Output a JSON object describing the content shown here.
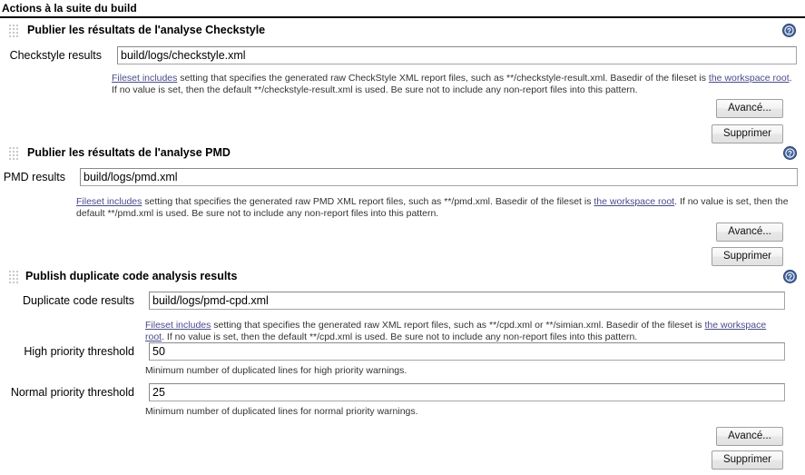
{
  "page": {
    "header_title": "Actions à la suite du build"
  },
  "icons": {
    "help": "help-icon",
    "drag": "drag-handle-icon"
  },
  "common": {
    "advanced_label": "Avancé...",
    "delete_label": "Supprimer",
    "fileset_includes_link": "Fileset includes",
    "workspace_root_link": "the workspace root"
  },
  "sections": [
    {
      "title": "Publier les résultats de l'analyse Checkstyle",
      "fields": [
        {
          "label": "Checkstyle results",
          "value": "build/logs/checkstyle.xml",
          "placeholder": ""
        }
      ],
      "description": {
        "link1": "Fileset includes",
        "text1": " setting that specifies the generated raw CheckStyle XML report files, such as **/checkstyle-result.xml. Basedir of the fileset is ",
        "link2": "the workspace root",
        "text2": ". If no value is set, then the default **/checkstyle-result.xml is used. Be sure not to include any non-report files into this pattern."
      },
      "buttons": [
        "Avancé...",
        "Supprimer"
      ]
    },
    {
      "title": "Publier les résultats de l'analyse PMD",
      "fields": [
        {
          "label": "PMD results",
          "value": "build/logs/pmd.xml",
          "placeholder": ""
        }
      ],
      "description": {
        "link1": "Fileset includes",
        "text1": " setting that specifies the generated raw PMD XML report files, such as **/pmd.xml. Basedir of the fileset is ",
        "link2": "the workspace root",
        "text2": ". If no value is set, then the default **/pmd.xml is used. Be sure not to include any non-report files into this pattern."
      },
      "buttons": [
        "Avancé...",
        "Supprimer"
      ]
    },
    {
      "title": "Publish duplicate code analysis results",
      "fields": [
        {
          "label": "Duplicate code results",
          "value": "build/logs/pmd-cpd.xml",
          "placeholder": ""
        },
        {
          "label": "High priority threshold",
          "value": "50",
          "help": "Minimum number of duplicated lines for high priority warnings."
        },
        {
          "label": "Normal priority threshold",
          "value": "25",
          "help": "Minimum number of duplicated lines for normal priority warnings."
        }
      ],
      "description": {
        "link1": "Fileset includes",
        "text1": " setting that specifies the generated raw XML report files, such as **/cpd.xml or **/simian.xml. Basedir of the fileset is ",
        "link2": "the workspace root",
        "text2": ". If no value is set, then the default **/cpd.xml is used. Be sure not to include any non-report files into this pattern."
      },
      "buttons": [
        "Avancé...",
        "Supprimer"
      ]
    }
  ],
  "colors": {
    "help_blue": "#43629c",
    "link_purple": "#4a4a8a",
    "rule_black": "#000000"
  }
}
